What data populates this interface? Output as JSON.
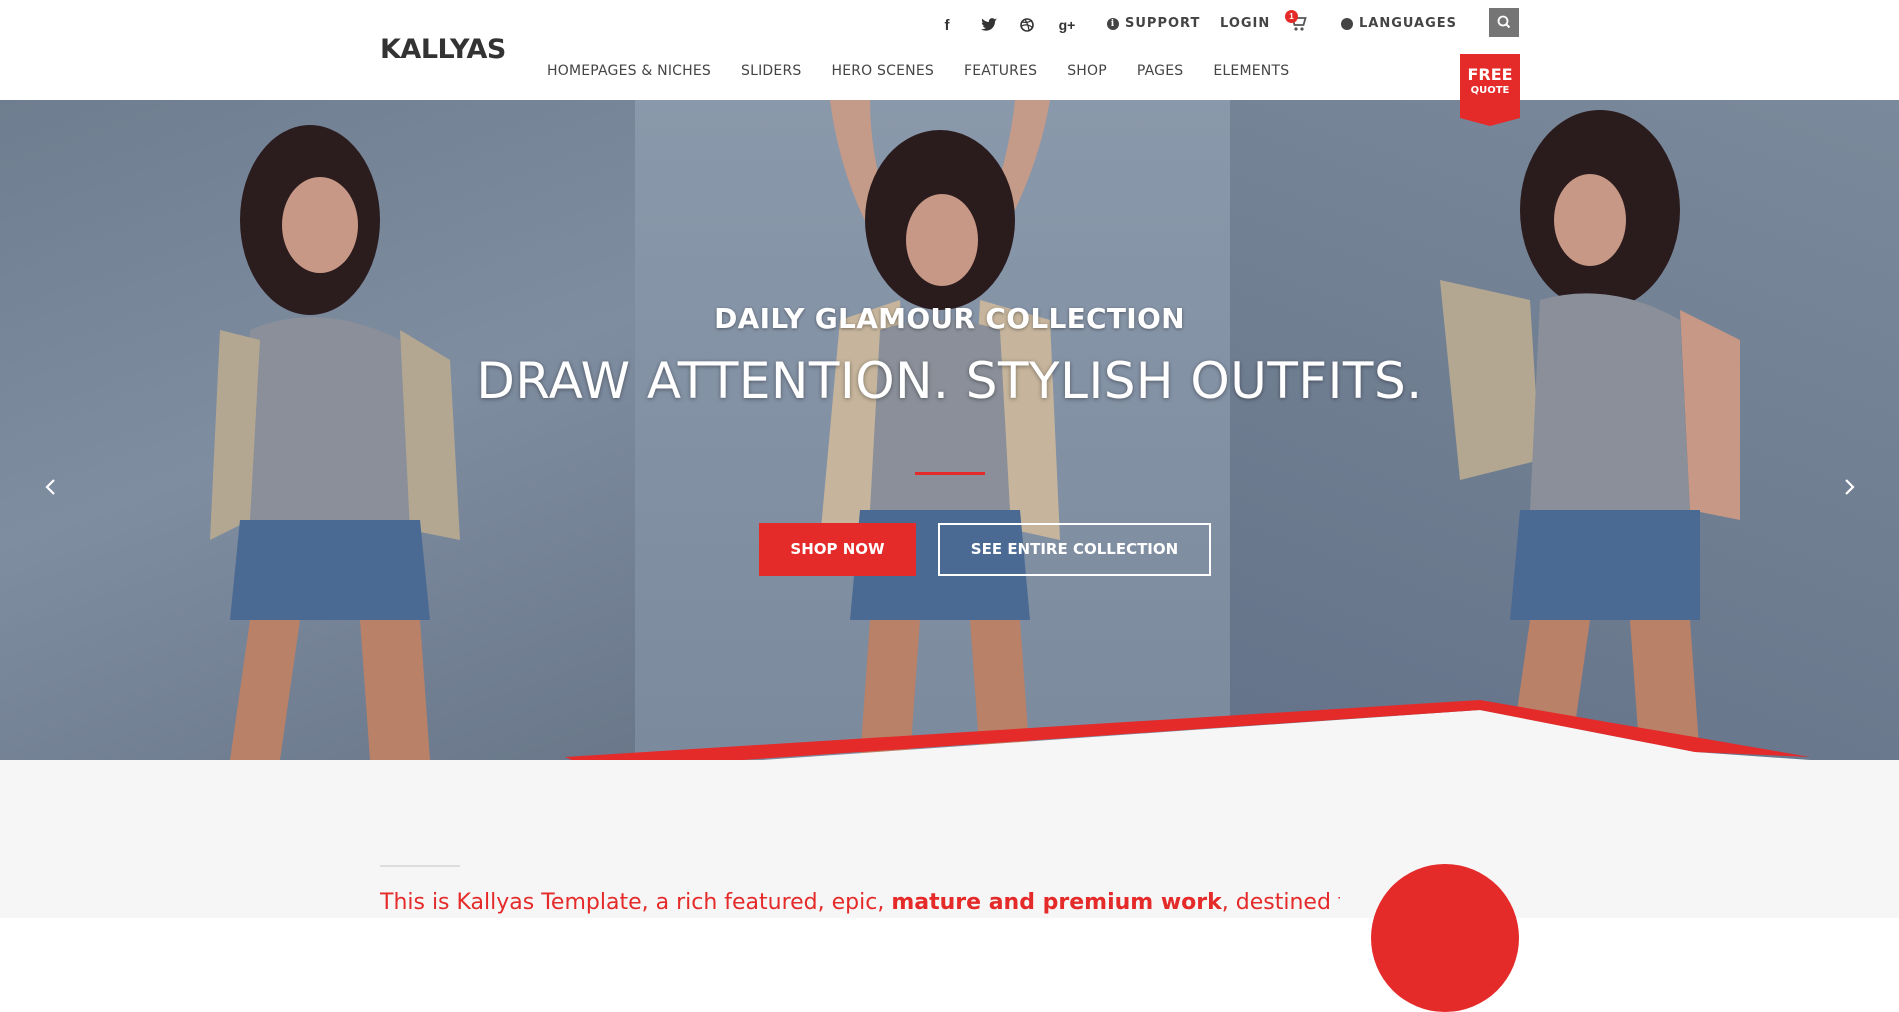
{
  "header": {
    "logo": "KALLYAS",
    "social": [
      "facebook-icon",
      "twitter-icon",
      "dribbble-icon",
      "google-plus-icon"
    ],
    "social_glyphs": {
      "facebook": "f",
      "google_plus": "g+"
    },
    "support_label": "SUPPORT",
    "login_label": "LOGIN",
    "cart_count": "1",
    "languages_label": "LANGUAGES",
    "nav": [
      "HOMEPAGES & NICHES",
      "SLIDERS",
      "HERO SCENES",
      "FEATURES",
      "SHOP",
      "PAGES",
      "ELEMENTS"
    ],
    "quote_line1": "FREE",
    "quote_line2": "QUOTE"
  },
  "hero": {
    "subtitle": "DAILY GLAMOUR COLLECTION",
    "title": "DRAW ATTENTION. STYLISH OUTFITS.",
    "shop_now": "SHOP NOW",
    "see_collection": "SEE ENTIRE COLLECTION"
  },
  "intro": {
    "part1": "This is Kallyas Template, a rich featured, epic, ",
    "bold": "mature and premium work",
    "part2": ", destined for"
  },
  "colors": {
    "accent": "#e52a2a",
    "text_dark": "#333333",
    "hero_bg": "#7a889b",
    "section_bg": "#f6f6f6"
  }
}
